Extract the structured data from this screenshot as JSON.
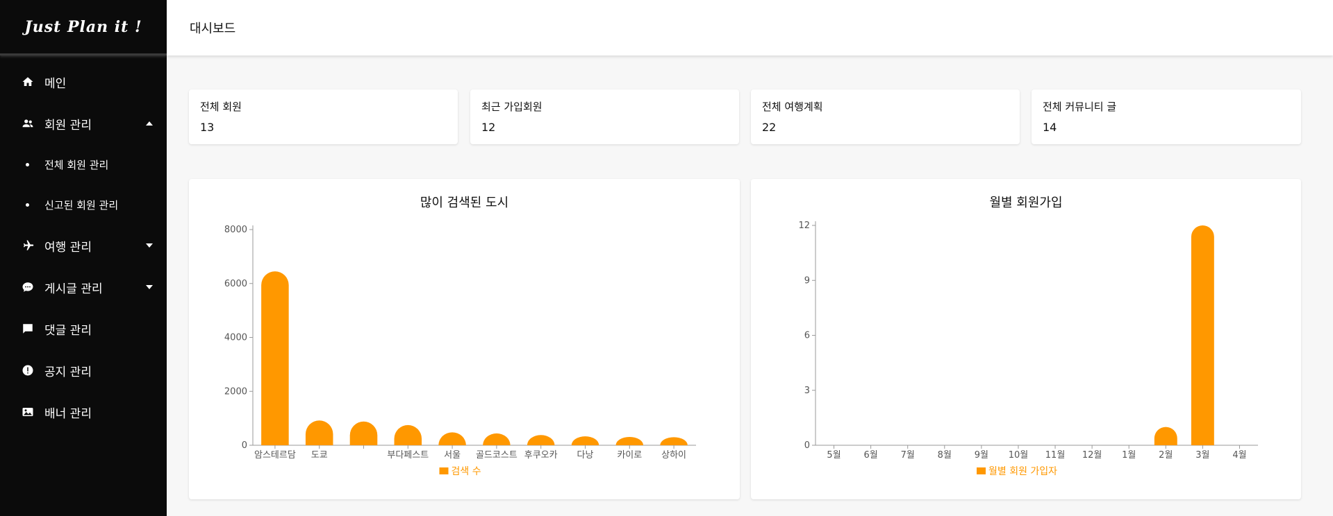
{
  "brand": {
    "logo_text": "Just Plan it !"
  },
  "header": {
    "title": "대시보드"
  },
  "sidebar": {
    "items": [
      {
        "label": "메인",
        "icon": "home-icon"
      },
      {
        "label": "회원 관리",
        "icon": "people-icon",
        "expanded": true,
        "children": [
          {
            "label": "전체 회원 관리"
          },
          {
            "label": "신고된 회원 관리"
          }
        ]
      },
      {
        "label": "여행 관리",
        "icon": "airplane-icon",
        "expanded": false
      },
      {
        "label": "게시글 관리",
        "icon": "chat-icon",
        "expanded": false
      },
      {
        "label": "댓글 관리",
        "icon": "comment-icon"
      },
      {
        "label": "공지 관리",
        "icon": "alert-icon"
      },
      {
        "label": "배너 관리",
        "icon": "image-icon"
      }
    ]
  },
  "stats": [
    {
      "label": "전체 회원",
      "value": "13"
    },
    {
      "label": "최근 가입회원",
      "value": "12"
    },
    {
      "label": "전체 여행계획",
      "value": "22"
    },
    {
      "label": "전체 커뮤니티 글",
      "value": "14"
    }
  ],
  "colors": {
    "accent": "#ff9800",
    "sidebar_bg": "#0b0b0b",
    "page_bg": "#f7f7f7"
  },
  "chart_data": [
    {
      "type": "bar",
      "title": "많이 검색된 도시",
      "categories": [
        "암스테르담",
        "도쿄",
        "",
        "부다페스트",
        "서울",
        "골드코스트",
        "후쿠오카",
        "다낭",
        "카이로",
        "상하이"
      ],
      "series": [
        {
          "name": "검색 수",
          "values": [
            6450,
            920,
            880,
            750,
            480,
            440,
            380,
            330,
            310,
            300
          ]
        }
      ],
      "ylim": [
        0,
        8000
      ],
      "yticks": [
        0,
        2000,
        4000,
        6000,
        8000
      ],
      "legend": "bottom"
    },
    {
      "type": "bar",
      "title": "월별 회원가입",
      "categories": [
        "5월",
        "6월",
        "7월",
        "8월",
        "9월",
        "10월",
        "11월",
        "12월",
        "1월",
        "2월",
        "3월",
        "4월"
      ],
      "series": [
        {
          "name": "월별 회원 가입자",
          "values": [
            0,
            0,
            0,
            0,
            0,
            0,
            0,
            0,
            0,
            1,
            12,
            0
          ]
        }
      ],
      "ylim": [
        0,
        12
      ],
      "yticks": [
        0,
        3,
        6,
        9,
        12
      ],
      "legend": "bottom"
    }
  ]
}
